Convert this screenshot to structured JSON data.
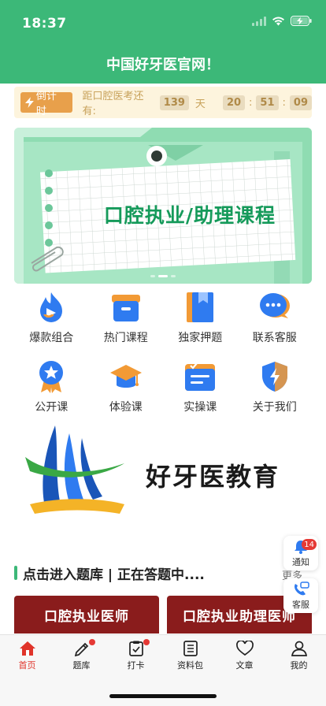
{
  "status_bar": {
    "time": "18:37"
  },
  "header": {
    "title": "中国好牙医官网！"
  },
  "countdown": {
    "tag": "倒计时",
    "label": "距口腔医考还有:",
    "days": "139",
    "day_unit": "天",
    "hours": "20",
    "minutes": "51",
    "seconds": "09"
  },
  "banner": {
    "title": "口腔执业/助理课程"
  },
  "grid": {
    "row1": [
      {
        "label": "爆款组合",
        "icon": "flame-icon"
      },
      {
        "label": "热门课程",
        "icon": "archive-box-icon"
      },
      {
        "label": "独家押题",
        "icon": "book-icon"
      },
      {
        "label": "联系客服",
        "icon": "chat-bubble-icon"
      }
    ],
    "row2": [
      {
        "label": "公开课",
        "icon": "medal-icon"
      },
      {
        "label": "体验课",
        "icon": "graduation-cap-icon"
      },
      {
        "label": "实操课",
        "icon": "checklist-icon"
      },
      {
        "label": "关于我们",
        "icon": "shield-bolt-icon"
      }
    ]
  },
  "brand": {
    "name": "好牙医教育"
  },
  "section": {
    "title": "点击进入题库 | 正在答题中....",
    "more": "更多"
  },
  "courses": [
    {
      "title": "口腔执业医师"
    },
    {
      "title": "口腔执业助理医师"
    }
  ],
  "float": {
    "notify_label": "通知",
    "notify_count": "14",
    "service_label": "客服"
  },
  "tabbar": {
    "items": [
      {
        "label": "首页",
        "icon": "home-icon",
        "active": true
      },
      {
        "label": "题库",
        "icon": "pencil-icon",
        "dot": true
      },
      {
        "label": "打卡",
        "icon": "clipboard-check-icon",
        "dot": true
      },
      {
        "label": "资料包",
        "icon": "list-doc-icon"
      },
      {
        "label": "文章",
        "icon": "heart-icon"
      },
      {
        "label": "我的",
        "icon": "user-icon"
      }
    ]
  },
  "colors": {
    "brand_green": "#3cb878",
    "countdown_bg": "#fdf4dd",
    "countdown_tag": "#e8a04b",
    "active_tab": "#e0342a",
    "badge_red": "#e53935",
    "course_card": "#8a1c1c"
  }
}
